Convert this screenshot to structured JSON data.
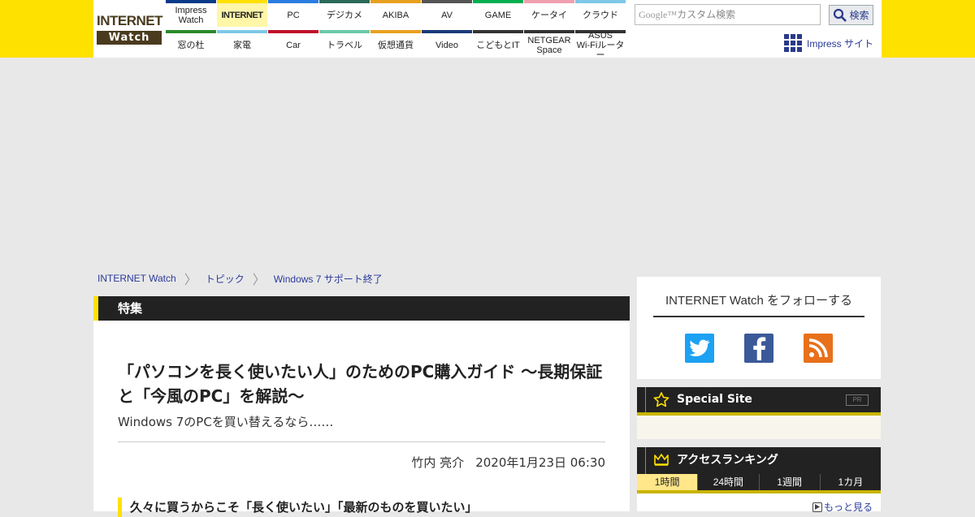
{
  "logo": {
    "line1": "INTERNET",
    "line2": "Watch"
  },
  "nav": {
    "top": [
      {
        "label": "Impress\nWatch",
        "color": "#0a3a8a"
      },
      {
        "label": "INTERNET",
        "color": "#ffe100",
        "active": true
      },
      {
        "label": "PC",
        "color": "#2a7de1"
      },
      {
        "label": "デジカメ",
        "color": "#2a6a5a"
      },
      {
        "label": "AKIBA",
        "color": "#e8a020"
      },
      {
        "label": "AV",
        "color": "#555555"
      },
      {
        "label": "GAME",
        "color": "#00b050"
      },
      {
        "label": "ケータイ",
        "color": "#f0a0b0"
      },
      {
        "label": "クラウド",
        "color": "#7ec8e8"
      }
    ],
    "bottom": [
      {
        "label": "窓の杜",
        "color": "#2a8a2a"
      },
      {
        "label": "家電",
        "color": "#7ec8e8"
      },
      {
        "label": "Car",
        "color": "#c0102a"
      },
      {
        "label": "トラベル",
        "color": "#6acaa8"
      },
      {
        "label": "仮想通貨",
        "color": "#e8a020"
      },
      {
        "label": "Video",
        "color": "#1a3a7a"
      },
      {
        "label": "こどもとIT",
        "color": "#333333"
      },
      {
        "label": "NETGEAR\nSpace",
        "color": "#333333"
      },
      {
        "label": "ASUS\nWi-Fiルーター",
        "color": "#333333"
      }
    ]
  },
  "search": {
    "google": "Google™",
    "placeholder": "カスタム検索",
    "button": "検索"
  },
  "impress_site": "Impress サイト",
  "breadcrumbs": [
    "INTERNET Watch",
    "トピック",
    "Windows 7 サポート終了"
  ],
  "section": "特集",
  "article": {
    "title": "「パソコンを長く使いたい人」のためのPC購入ガイド ～長期保証と「今風のPC」を解説～",
    "subtitle": "Windows 7のPCを買い替えるなら……",
    "author": "竹内 亮介",
    "date": "2020年1月23日 06:30",
    "heading": "久々に買うからこそ「長く使いたい」「最新のものを買いたい」"
  },
  "follow": {
    "title": "INTERNET Watch をフォローする"
  },
  "special": {
    "title": "Special Site",
    "pr": "PR"
  },
  "ranking": {
    "title": "アクセスランキング",
    "tabs": [
      "1時間",
      "24時間",
      "1週間",
      "1カ月"
    ],
    "more": "もっと見る"
  },
  "colors": {
    "brand_yellow": "#ffe100",
    "twitter": "#1da1f2",
    "facebook": "#3b5998",
    "rss": "#e8701a"
  }
}
